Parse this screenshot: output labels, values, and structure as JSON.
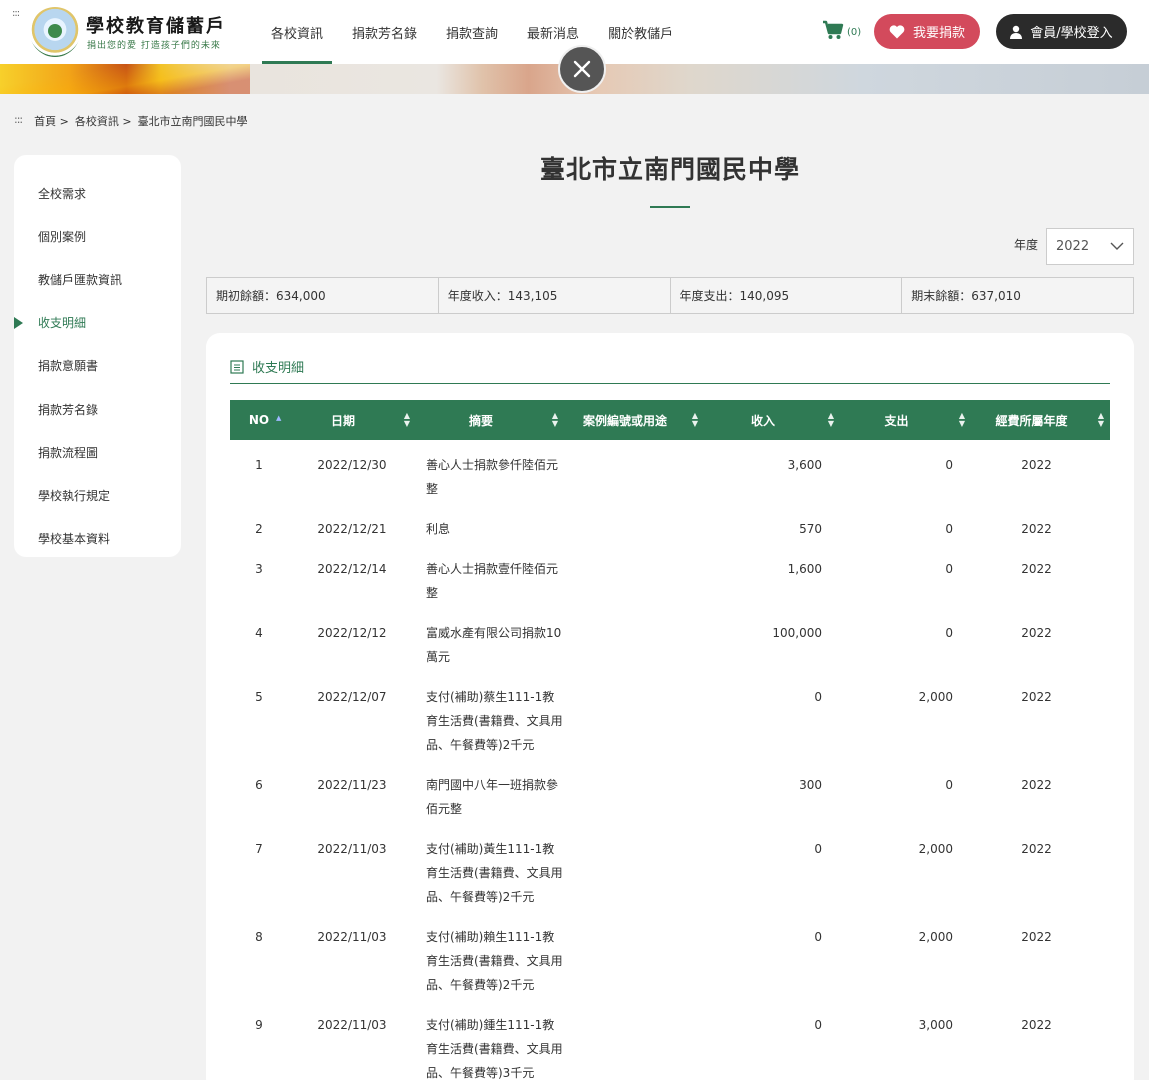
{
  "header": {
    "skip_mark": ":::",
    "brand_title": "學校教育儲蓄戶",
    "brand_sub": "捐出您的愛 打造孩子們的未來",
    "nav": [
      "各校資訊",
      "捐款芳名錄",
      "捐款查詢",
      "最新消息",
      "關於教儲戶"
    ],
    "cart_count": "(0)",
    "donate_label": "我要捐款",
    "login_label": "會員/學校登入"
  },
  "breadcrumb": {
    "dots": ":::",
    "items": [
      "首頁 >",
      "各校資訊 >",
      "臺北市立南門國民中學"
    ]
  },
  "sidebar": {
    "items": [
      "全校需求",
      "個別案例",
      "教儲戶匯款資訊",
      "收支明細",
      "捐款意願書",
      "捐款芳名錄",
      "捐款流程圖",
      "學校執行規定",
      "學校基本資料"
    ],
    "active_index": 3
  },
  "main": {
    "school_title": "臺北市立南門國民中學",
    "year_label": "年度",
    "year_value": "2022",
    "summary": [
      "期初餘額：634,000",
      "年度收入：143,105",
      "年度支出：140,095",
      "期末餘額：637,010"
    ],
    "panel_title": "收支明細"
  },
  "table": {
    "headers": [
      "NO",
      "日期",
      "摘要",
      "案例編號或用途",
      "收入",
      "支出",
      "經費所屬年度"
    ],
    "rows": [
      {
        "no": "1",
        "date": "2022/12/30",
        "desc": "善心人士捐款參仟陸佰元整",
        "case": "",
        "income": "3,600",
        "expense": "0",
        "year": "2022"
      },
      {
        "no": "2",
        "date": "2022/12/21",
        "desc": "利息",
        "case": "",
        "income": "570",
        "expense": "0",
        "year": "2022"
      },
      {
        "no": "3",
        "date": "2022/12/14",
        "desc": "善心人士捐款壹仟陸佰元整",
        "case": "",
        "income": "1,600",
        "expense": "0",
        "year": "2022"
      },
      {
        "no": "4",
        "date": "2022/12/12",
        "desc": "富威水產有限公司捐款10萬元",
        "case": "",
        "income": "100,000",
        "expense": "0",
        "year": "2022"
      },
      {
        "no": "5",
        "date": "2022/12/07",
        "desc": "支付(補助)蔡生111-1教育生活費(書籍費、文具用品、午餐費等)2千元",
        "case": "",
        "income": "0",
        "expense": "2,000",
        "year": "2022"
      },
      {
        "no": "6",
        "date": "2022/11/23",
        "desc": "南門國中八年一班捐款參佰元整",
        "case": "",
        "income": "300",
        "expense": "0",
        "year": "2022"
      },
      {
        "no": "7",
        "date": "2022/11/03",
        "desc": "支付(補助)黃生111-1教育生活費(書籍費、文具用品、午餐費等)2千元",
        "case": "",
        "income": "0",
        "expense": "2,000",
        "year": "2022"
      },
      {
        "no": "8",
        "date": "2022/11/03",
        "desc": "支付(補助)賴生111-1教育生活費(書籍費、文具用品、午餐費等)2千元",
        "case": "",
        "income": "0",
        "expense": "2,000",
        "year": "2022"
      },
      {
        "no": "9",
        "date": "2022/11/03",
        "desc": "支付(補助)鍾生111-1教育生活費(書籍費、文具用品、午餐費等)3千元",
        "case": "",
        "income": "0",
        "expense": "3,000",
        "year": "2022"
      }
    ]
  },
  "colors": {
    "accent": "#2f7a54",
    "donate": "#d34a5c",
    "login": "#2b2b2b"
  },
  "icons": [
    "cart-icon",
    "heart-icon",
    "user-icon",
    "close-icon",
    "chevron-down-icon",
    "document-icon",
    "sort-icon"
  ]
}
